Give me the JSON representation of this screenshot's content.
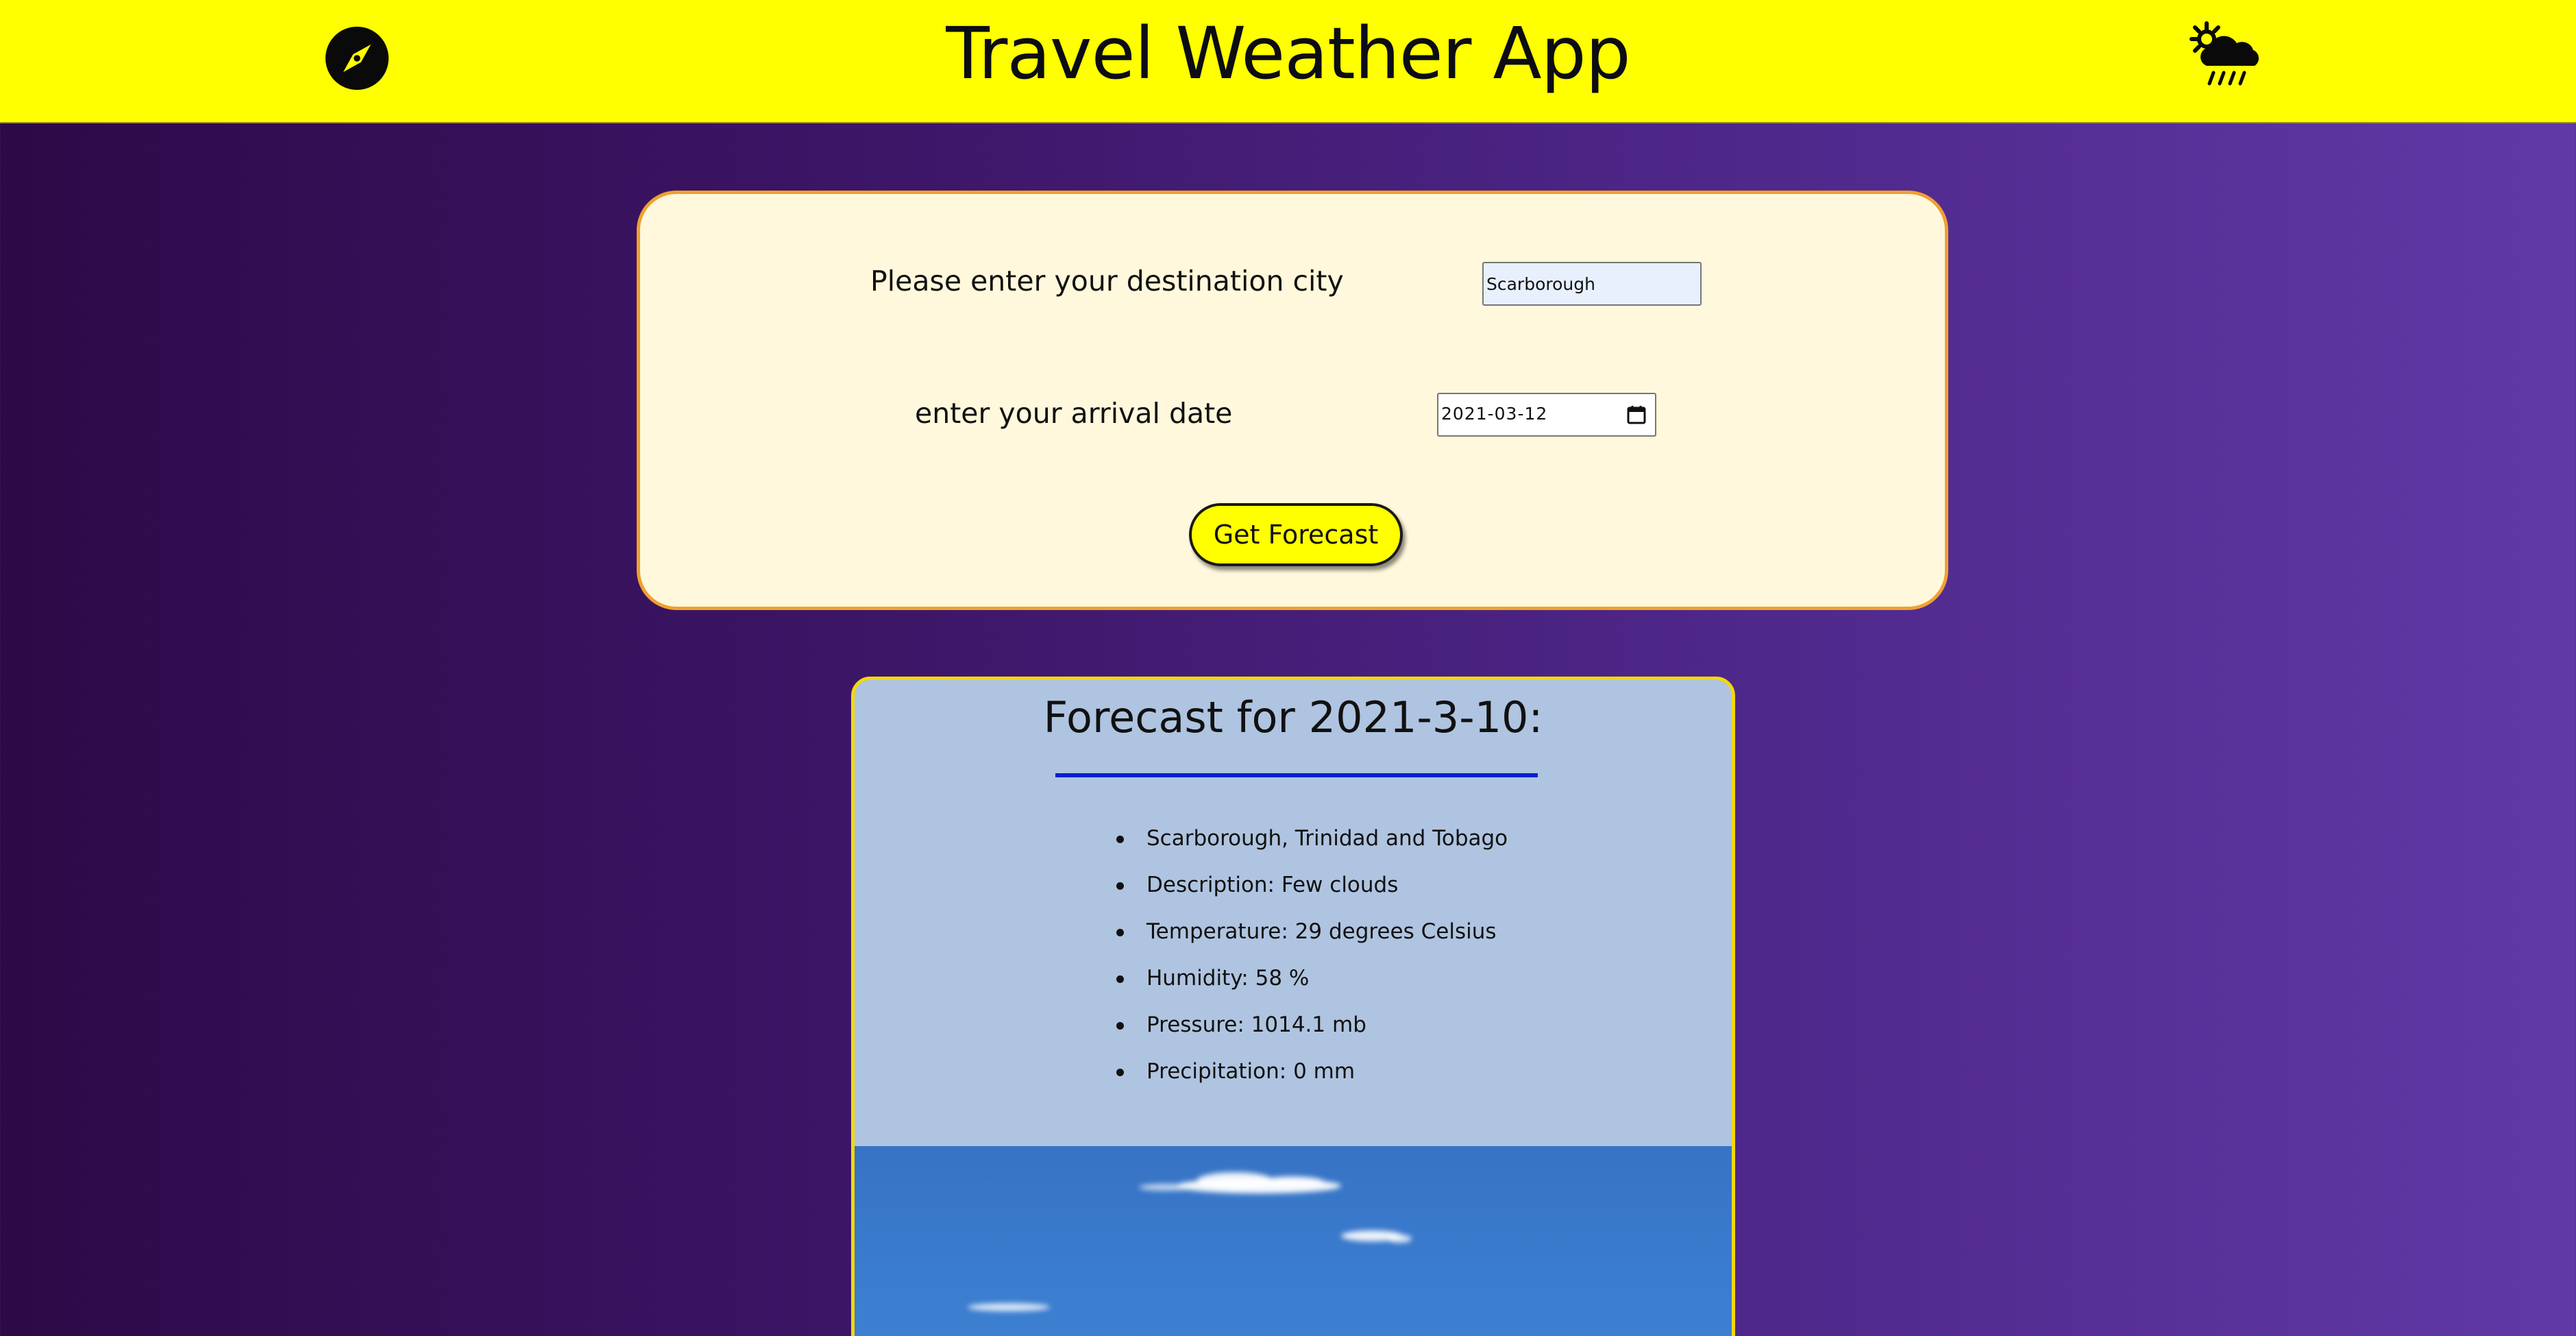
{
  "header": {
    "title": "Travel Weather App",
    "background": "#ffff00",
    "left_icon": "compass-icon",
    "right_icon": "sun-cloud-rain-icon"
  },
  "form": {
    "city_label": "Please enter your destination city",
    "city_value": "Scarborough",
    "date_label": "enter your arrival date",
    "date_value": "2021-03-12",
    "calendar_icon": "calendar-icon",
    "submit_label": "Get Forecast"
  },
  "forecast": {
    "title": "Forecast for 2021-3-10:",
    "items": [
      "Scarborough, Trinidad and Tobago",
      "Description: Few clouds",
      "Temperature: 29 degrees Celsius",
      "Humidity: 58 %",
      "Pressure: 1014.1 mb",
      "Precipitation: 0 mm"
    ],
    "image": "sky-with-clouds-photo"
  },
  "colors": {
    "accent": "#ffff00",
    "card_background": "#fff8dc",
    "card_border": "#f0a030",
    "result_background": "#afc4e0",
    "title_underline": "#0a1fcc"
  }
}
